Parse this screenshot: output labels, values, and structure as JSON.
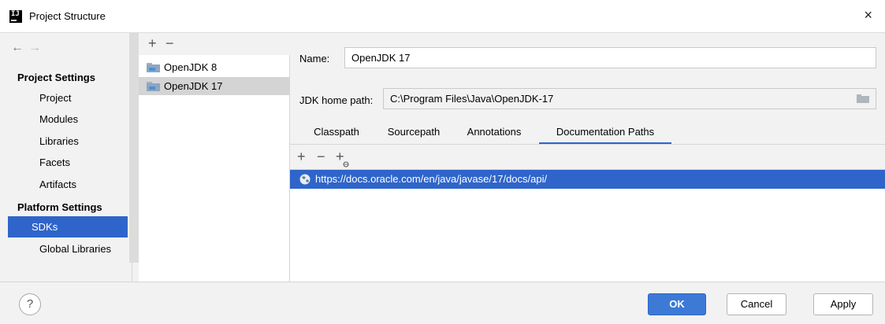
{
  "window": {
    "title": "Project Structure",
    "close_icon": "×",
    "app_icon": "IJ"
  },
  "nav": {
    "back_icon": "←",
    "forward_icon": "→",
    "project_settings_heading": "Project Settings",
    "project_items": [
      "Project",
      "Modules",
      "Libraries",
      "Facets",
      "Artifacts"
    ],
    "platform_settings_heading": "Platform Settings",
    "platform_items": [
      "SDKs",
      "Global Libraries"
    ],
    "selected": "SDKs"
  },
  "sdk_list": {
    "add_icon": "+",
    "remove_icon": "−",
    "items": [
      "OpenJDK 8",
      "OpenJDK 17"
    ],
    "selected": "OpenJDK 17"
  },
  "detail": {
    "name_label": "Name:",
    "name_value": "OpenJDK 17",
    "home_label": "JDK home path:",
    "home_value": "C:\\Program Files\\Java\\OpenJDK-17",
    "tabs": [
      "Classpath",
      "Sourcepath",
      "Annotations",
      "Documentation Paths"
    ],
    "active_tab": "Documentation Paths",
    "toolbar": {
      "add_icon": "+",
      "remove_icon": "−",
      "add_url_icon": "+"
    },
    "doc_paths": [
      "https://docs.oracle.com/en/java/javase/17/docs/api/"
    ]
  },
  "buttons": {
    "help": "?",
    "ok": "OK",
    "cancel": "Cancel",
    "apply": "Apply"
  },
  "colors": {
    "accent": "#2f65ca",
    "ok_button": "#3c7ad6",
    "panel": "#f2f2f2"
  }
}
